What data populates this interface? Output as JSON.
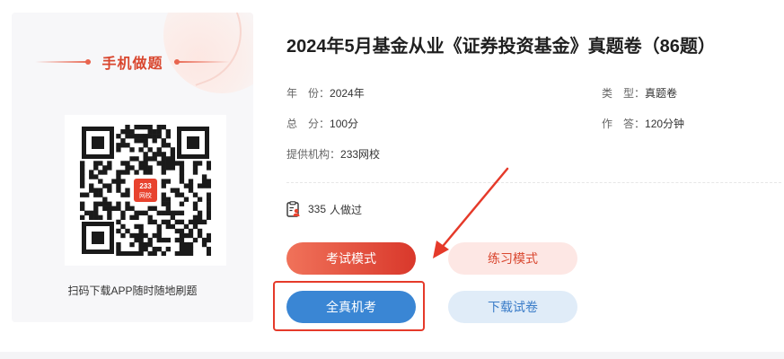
{
  "qr_panel": {
    "title": "手机做题",
    "caption": "扫码下载APP随时随地刷题",
    "logo_line1": "233",
    "logo_line2": "网校"
  },
  "exam": {
    "title": "2024年5月基金从业《证券投资基金》真题卷（86题）",
    "meta": {
      "year_label": "年　份：",
      "year_value": "2024年",
      "type_label": "类　型：",
      "type_value": "真题卷",
      "score_label": "总　分：",
      "score_value": "100分",
      "time_label": "作　答：",
      "time_value": "120分钟",
      "provider_label": "提供机构：",
      "provider_value": "233网校"
    },
    "done_count": "335",
    "done_suffix": "人做过"
  },
  "buttons": {
    "exam_mode": "考试模式",
    "practice_mode": "练习模式",
    "real_exam": "全真机考",
    "download": "下载试卷"
  },
  "colors": {
    "accent_red": "#d9382b",
    "accent_blue": "#3a86d4",
    "annotation_red": "#e53a2a"
  },
  "icons": {
    "done": "clipboard-user-icon",
    "annotation": "red-arrow"
  }
}
